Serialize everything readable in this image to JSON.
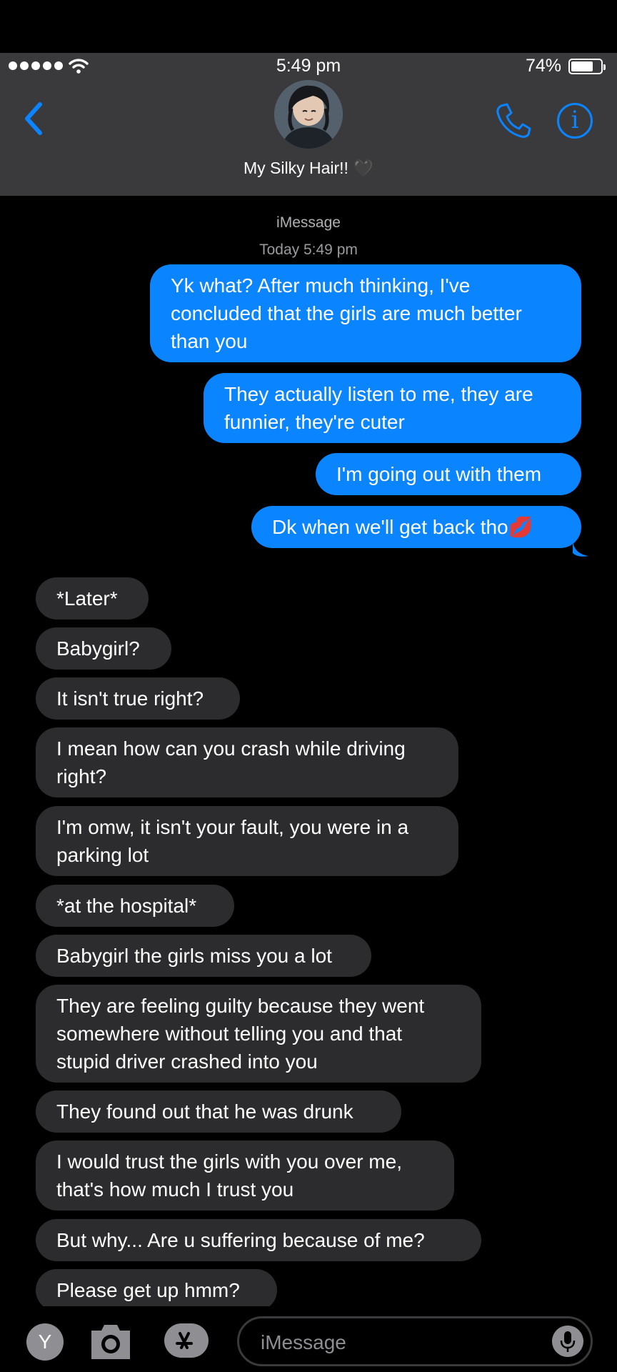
{
  "status_bar": {
    "time": "5:49 pm",
    "battery": "74%",
    "battery_level": 0.74
  },
  "header": {
    "contact_name": "My Silky Hair!! 🖤"
  },
  "thread": {
    "service": "iMessage",
    "timestamp": "Today 5:49 pm"
  },
  "messages": [
    {
      "dir": "sent",
      "text": "Yk what? After much thinking, I've concluded that the girls are much better than you"
    },
    {
      "dir": "sent",
      "text": "They actually listen to me, they are funnier, they're cuter"
    },
    {
      "dir": "sent",
      "text": "I'm going out with them"
    },
    {
      "dir": "sent",
      "text": "Dk when we'll get back tho💋"
    },
    {
      "dir": "received",
      "text": "*Later*"
    },
    {
      "dir": "received",
      "text": "Babygirl?"
    },
    {
      "dir": "received",
      "text": "It isn't true right?"
    },
    {
      "dir": "received",
      "text": "I mean how can you crash while driving right?"
    },
    {
      "dir": "received",
      "text": "I'm omw, it isn't your fault, you were in a parking lot"
    },
    {
      "dir": "received",
      "text": "*at the hospital*"
    },
    {
      "dir": "received",
      "text": "Babygirl the girls miss you a lot"
    },
    {
      "dir": "received",
      "text": "They are feeling guilty because they went somewhere without telling you and that stupid driver crashed into you"
    },
    {
      "dir": "received",
      "text": "They found out that he was drunk"
    },
    {
      "dir": "received",
      "text": "I would trust the girls with you over me, that's how much I trust you"
    },
    {
      "dir": "received",
      "text": "But why... Are u suffering because of me?"
    },
    {
      "dir": "received",
      "text": "Please get up hmm?"
    }
  ],
  "composer": {
    "user_initial": "Y",
    "placeholder": "iMessage"
  },
  "colors": {
    "accent": "#0a84ff",
    "header_bg": "#3a3a3c",
    "received_bubble": "#2c2c2e",
    "sent_bubble": "#0a84ff"
  },
  "icons": {
    "back": "chevron-left-icon",
    "phone": "phone-icon",
    "info": "info-icon",
    "camera": "camera-icon",
    "apps": "app-store-icon",
    "mic": "microphone-icon"
  }
}
